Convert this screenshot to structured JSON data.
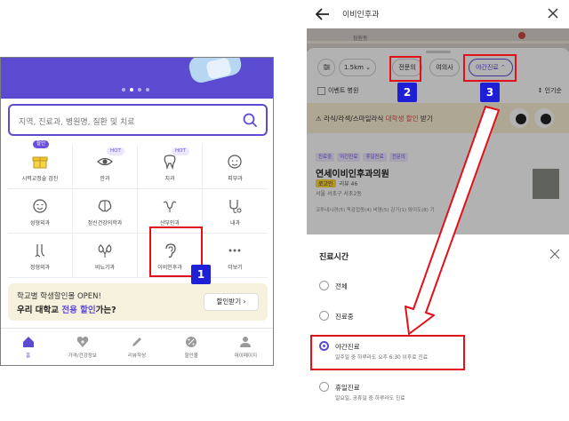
{
  "left": {
    "search_placeholder": "지역, 진료과, 병원명, 질환 및 치료",
    "categories": [
      {
        "label": "시력교정술 검진",
        "badge": "할인",
        "icon": "gift-icon"
      },
      {
        "label": "안과",
        "badge": "HOT",
        "icon": "eye-icon"
      },
      {
        "label": "치과",
        "badge": "HOT",
        "icon": "tooth-icon"
      },
      {
        "label": "피부과",
        "badge": "",
        "icon": "face-icon"
      },
      {
        "label": "성형외과",
        "badge": "",
        "icon": "smile-face-icon"
      },
      {
        "label": "정신건강의학과",
        "badge": "",
        "icon": "brain-icon"
      },
      {
        "label": "산부인과",
        "badge": "",
        "icon": "uterus-icon"
      },
      {
        "label": "내과",
        "badge": "",
        "icon": "stethoscope-icon"
      },
      {
        "label": "정형외과",
        "badge": "",
        "icon": "bone-icon"
      },
      {
        "label": "비뇨기과",
        "badge": "",
        "icon": "kidney-icon"
      },
      {
        "label": "이비인후과",
        "badge": "",
        "icon": "ear-icon"
      },
      {
        "label": "더보기",
        "badge": "",
        "icon": "more-icon"
      }
    ],
    "promo": {
      "line1": "학교별 학생할인몰 OPEN!",
      "line2_prefix": "우리 대학교 ",
      "line2_highlight": "전용 할인",
      "line2_suffix": "가는?",
      "button": "할인받기 ›"
    },
    "tabs": [
      "홈",
      "가격/건강정보",
      "리뷰작성",
      "할인몰",
      "마이페이지"
    ]
  },
  "right": {
    "query": "이비인후과",
    "map_label": "잠원동",
    "chips": [
      "1.5km ⌄",
      "전문의",
      "여의사",
      "야간진료 ⌃"
    ],
    "event_checkbox": "이벤트 병원",
    "sort": "↕ 인기순",
    "banner": {
      "text_prefix": "라식/라섹/스마일라식 ",
      "text_highlight": "대학생 할인",
      "text_suffix": " 받기"
    },
    "clinic": {
      "tags": [
        "진료중",
        "야간진료",
        "휴일진료",
        "전문의"
      ],
      "name": "연세이비인후과의원",
      "logo": "로고인",
      "reviews": "리뷰 46",
      "address": "서울 서초구 서초2동",
      "services": "코투내시경(5)   독감접종(4)   비염(5)   감기(1)   와이도(8)   기"
    },
    "modal": {
      "title": "진료시간",
      "options": [
        {
          "label": "전체",
          "sub": "",
          "selected": false
        },
        {
          "label": "진료중",
          "sub": "",
          "selected": false
        },
        {
          "label": "야간진료",
          "sub": "일주일 중 하루라도 오후 6:30 이후로 진료",
          "selected": true
        },
        {
          "label": "휴일진료",
          "sub": "일요일, 공휴일 중 하루라도 진료",
          "selected": false
        }
      ]
    }
  },
  "annotations": {
    "step1": "1",
    "step2": "2",
    "step3": "3"
  },
  "colors": {
    "brand": "#5b4bd0",
    "highlight": "#e0111a",
    "step_badge": "#1f1fd6"
  }
}
